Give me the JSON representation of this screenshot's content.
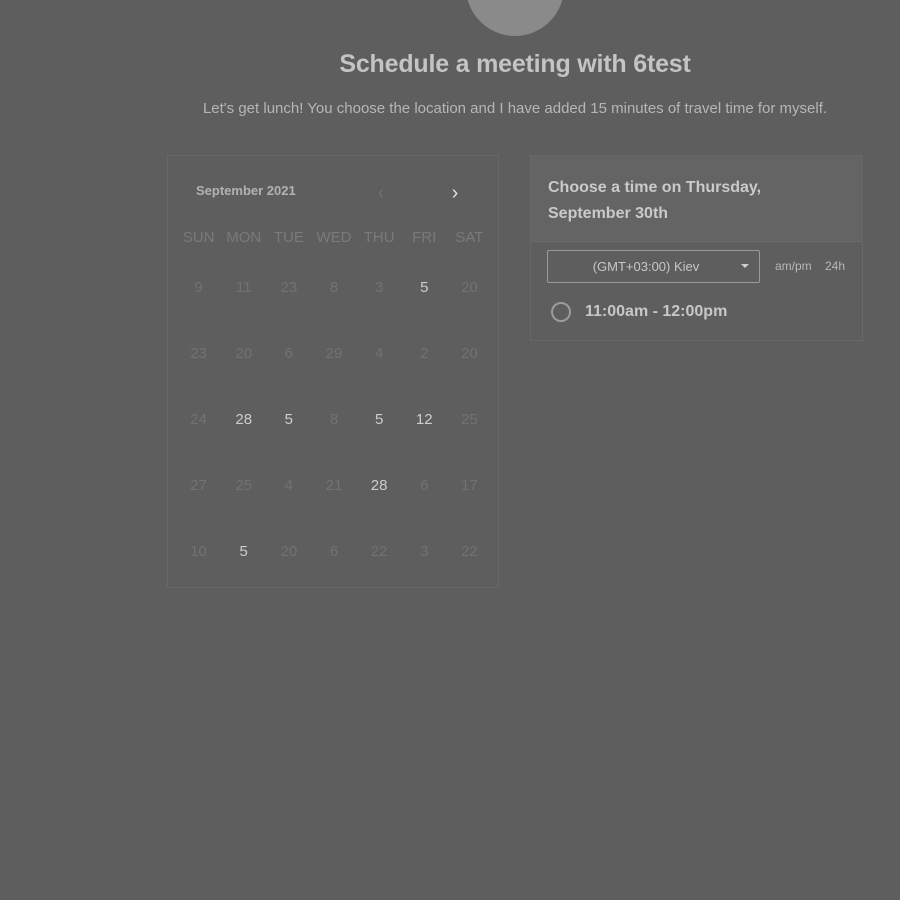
{
  "header": {
    "title": "Schedule a meeting with 6test",
    "description": "Let's get lunch! You choose the location and I have added 15 minutes of travel time for myself."
  },
  "calendar": {
    "month_label": "September 2021",
    "prev_icon": "chevron-left-icon",
    "next_icon": "chevron-right-icon",
    "weekdays": [
      "SUN",
      "MON",
      "TUE",
      "WED",
      "THU",
      "FRI",
      "SAT"
    ],
    "weeks": [
      [
        {
          "label": "9",
          "available": false
        },
        {
          "label": "11",
          "available": false
        },
        {
          "label": "23",
          "available": false
        },
        {
          "label": "8",
          "available": false
        },
        {
          "label": "3",
          "available": false
        },
        {
          "label": "5",
          "available": true
        },
        {
          "label": "20",
          "available": false
        }
      ],
      [
        {
          "label": "23",
          "available": false
        },
        {
          "label": "20",
          "available": false
        },
        {
          "label": "6",
          "available": false
        },
        {
          "label": "29",
          "available": false
        },
        {
          "label": "4",
          "available": false
        },
        {
          "label": "2",
          "available": false
        },
        {
          "label": "20",
          "available": false
        }
      ],
      [
        {
          "label": "24",
          "available": false
        },
        {
          "label": "28",
          "available": true
        },
        {
          "label": "5",
          "available": true
        },
        {
          "label": "8",
          "available": false
        },
        {
          "label": "5",
          "available": true
        },
        {
          "label": "12",
          "available": true
        },
        {
          "label": "25",
          "available": false
        }
      ],
      [
        {
          "label": "27",
          "available": false
        },
        {
          "label": "25",
          "available": false
        },
        {
          "label": "4",
          "available": false
        },
        {
          "label": "21",
          "available": false
        },
        {
          "label": "28",
          "available": true
        },
        {
          "label": "6",
          "available": false
        },
        {
          "label": "17",
          "available": false
        }
      ],
      [
        {
          "label": "10",
          "available": false
        },
        {
          "label": "5",
          "available": true
        },
        {
          "label": "20",
          "available": false
        },
        {
          "label": "6",
          "available": false
        },
        {
          "label": "22",
          "available": false
        },
        {
          "label": "3",
          "available": false
        },
        {
          "label": "22",
          "available": false
        }
      ]
    ]
  },
  "time_panel": {
    "title": "Choose a time on Thursday, September 30th",
    "timezone": "(GMT+03:00) Kiev",
    "format_ampm": "am/pm",
    "format_24h": "24h",
    "slots": [
      "11:00am - 12:00pm"
    ]
  }
}
